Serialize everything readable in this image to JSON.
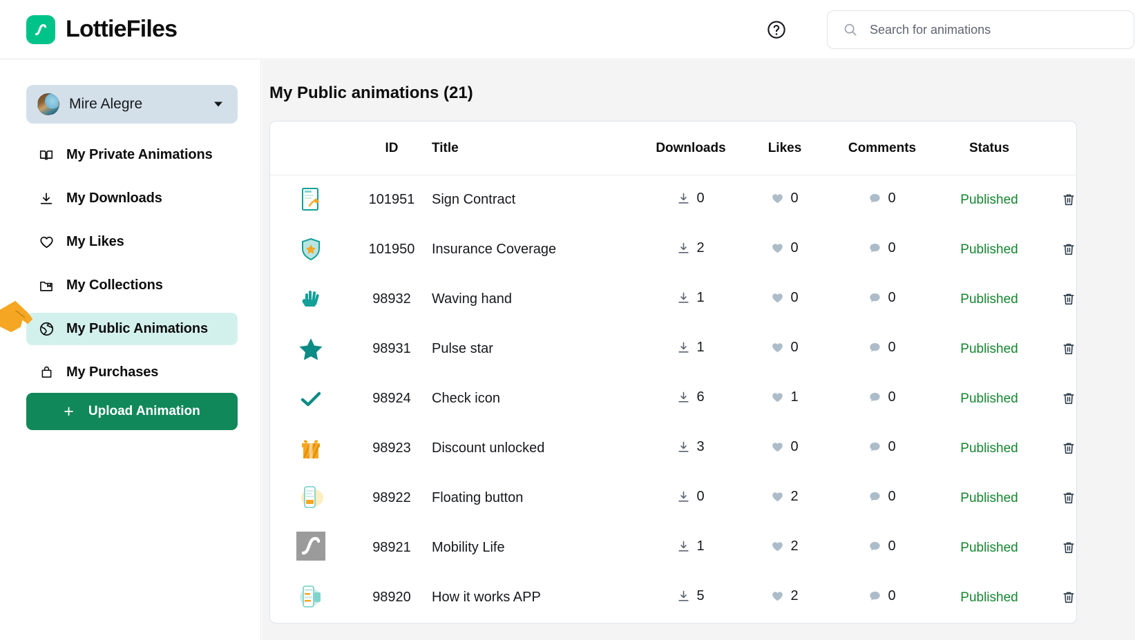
{
  "brand": {
    "name": "LottieFiles",
    "mark_color": "#00c389",
    "logo_icon": "lottie-squiggle-icon"
  },
  "topbar": {
    "help_icon": "help-circle-icon",
    "search": {
      "icon": "search-icon",
      "placeholder": "Search for animations",
      "value": ""
    }
  },
  "sidebar": {
    "user": {
      "name": "Mire Alegre",
      "avatar_icon": "user-avatar",
      "caret_icon": "chevron-down-icon"
    },
    "items": [
      {
        "label": "My Private Animations",
        "icon": "book-icon",
        "active": false
      },
      {
        "label": "My Downloads",
        "icon": "download-icon",
        "active": false
      },
      {
        "label": "My Likes",
        "icon": "heart-outline-icon",
        "active": false
      },
      {
        "label": "My Collections",
        "icon": "folder-bookmark-icon",
        "active": false
      },
      {
        "label": "My Public Animations",
        "icon": "globe-icon",
        "active": true
      },
      {
        "label": "My Purchases",
        "icon": "shopping-bag-icon",
        "active": false
      }
    ],
    "upload_button": {
      "label": "Upload Animation",
      "plus": "+",
      "color": "#11885a"
    },
    "active_bg": "#d3f1ec"
  },
  "cursor": {
    "icon": "pointing-hand-cursor",
    "color": "#f5a623"
  },
  "main": {
    "page_title": "My Public animations (21)",
    "table": {
      "columns": [
        "",
        "ID",
        "Title",
        "Downloads",
        "Likes",
        "Comments",
        "Status",
        ""
      ],
      "status_color": "#14862f",
      "rows": [
        {
          "thumb": "sign-contract-thumb",
          "id": "101951",
          "title": "Sign Contract",
          "downloads": "0",
          "likes": "0",
          "comments": "0",
          "status": "Published",
          "delete_icon": "trash-icon"
        },
        {
          "thumb": "shield-star-thumb",
          "id": "101950",
          "title": "Insurance Coverage",
          "downloads": "2",
          "likes": "0",
          "comments": "0",
          "status": "Published",
          "delete_icon": "trash-icon"
        },
        {
          "thumb": "waving-hand-thumb",
          "id": "98932",
          "title": "Waving hand",
          "downloads": "1",
          "likes": "0",
          "comments": "0",
          "status": "Published",
          "delete_icon": "trash-icon"
        },
        {
          "thumb": "star-thumb",
          "id": "98931",
          "title": "Pulse star",
          "downloads": "1",
          "likes": "0",
          "comments": "0",
          "status": "Published",
          "delete_icon": "trash-icon"
        },
        {
          "thumb": "check-thumb",
          "id": "98924",
          "title": "Check icon",
          "downloads": "6",
          "likes": "1",
          "comments": "0",
          "status": "Published",
          "delete_icon": "trash-icon"
        },
        {
          "thumb": "gift-thumb",
          "id": "98923",
          "title": "Discount unlocked",
          "downloads": "3",
          "likes": "0",
          "comments": "0",
          "status": "Published",
          "delete_icon": "trash-icon"
        },
        {
          "thumb": "phone-yellow-thumb",
          "id": "98922",
          "title": "Floating button",
          "downloads": "0",
          "likes": "2",
          "comments": "0",
          "status": "Published",
          "delete_icon": "trash-icon"
        },
        {
          "thumb": "lottie-gray-thumb",
          "id": "98921",
          "title": "Mobility Life",
          "downloads": "1",
          "likes": "2",
          "comments": "0",
          "status": "Published",
          "delete_icon": "trash-icon"
        },
        {
          "thumb": "phone-teal-thumb",
          "id": "98920",
          "title": "How it works APP",
          "downloads": "5",
          "likes": "2",
          "comments": "0",
          "status": "Published",
          "delete_icon": "trash-icon"
        }
      ]
    }
  }
}
